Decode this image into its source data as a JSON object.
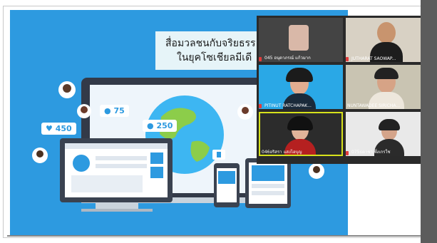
{
  "slide": {
    "title_line1": "สื่อมวลชนกับจริยธรร",
    "title_line2": "ในยุคโซเชียลมีเดี",
    "stats": {
      "likes": "450",
      "followers": "75",
      "comments": "250"
    }
  },
  "participants": [
    {
      "name": "045 อนุดาภรณ์ แก้วมาก"
    },
    {
      "name": "JUTHARAT SAOWAP..."
    },
    {
      "name": "PITINUT RATCHAPAK..."
    },
    {
      "name": "NUNTAWADEE SIRICHA..."
    },
    {
      "name": "046อริสรา แสงไอบุญ"
    },
    {
      "name": "075ธดาชา พึ่งเกรใช"
    }
  ],
  "colors": {
    "slide_bg": "#2d9ae0",
    "gallery_bg": "#2a2a2a",
    "active_border": "#d7e21c"
  }
}
